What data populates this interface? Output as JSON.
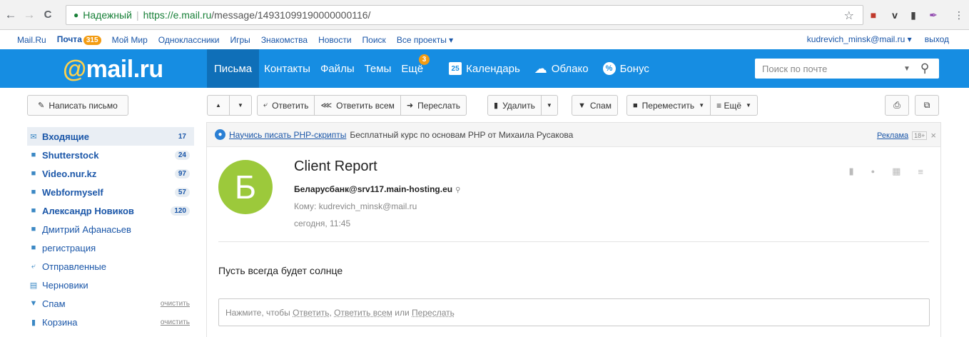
{
  "browser": {
    "back": "←",
    "forward": "→",
    "reload": "C",
    "lock": "🔒",
    "secure_label": "Надежный",
    "url_host": "https://e.mail.ru",
    "url_path": "/message/14931099190000000116/",
    "star": "☆"
  },
  "portal": {
    "links": [
      "Mail.Ru",
      "Почта",
      "Мой Мир",
      "Одноклассники",
      "Игры",
      "Знакомства",
      "Новости",
      "Поиск",
      "Все проекты ▾"
    ],
    "mail_count": "315",
    "user": "kudrevich_minsk@mail.ru ▾",
    "logout": "выход"
  },
  "header": {
    "logo_at": "@",
    "logo_text": "mail.ru",
    "nav": [
      "Письма",
      "Контакты",
      "Файлы",
      "Темы",
      "Ещё"
    ],
    "more_badge": "3",
    "calendar_day": "25",
    "calendar": "Календарь",
    "cloud": "Облако",
    "bonus": "Бонус",
    "search_placeholder": "Поиск по почте"
  },
  "toolbar": {
    "compose": "Написать письмо",
    "reply": "Ответить",
    "reply_all": "Ответить всем",
    "forward": "Переслать",
    "delete": "Удалить",
    "spam": "Спам",
    "move": "Переместить",
    "more": "≡ Ещё"
  },
  "sidebar": {
    "folders": [
      {
        "label": "Входящие",
        "count": "17",
        "bold": true
      },
      {
        "label": "Shutterstock",
        "count": "24",
        "bold": true
      },
      {
        "label": "Video.nur.kz",
        "count": "97",
        "bold": true
      },
      {
        "label": "Webformyself",
        "count": "57",
        "bold": true
      },
      {
        "label": "Александр Новиков",
        "count": "120",
        "bold": true
      },
      {
        "label": "Дмитрий Афанасьев",
        "count": "",
        "bold": false
      },
      {
        "label": "регистрация",
        "count": "",
        "bold": false
      },
      {
        "label": "Отправленные",
        "count": "",
        "bold": false
      },
      {
        "label": "Черновики",
        "count": "",
        "bold": false
      },
      {
        "label": "Спам",
        "clear": "очистить",
        "bold": false
      },
      {
        "label": "Корзина",
        "clear": "очистить",
        "bold": false
      }
    ]
  },
  "ad": {
    "link": "Научись писать PHP-скрипты",
    "text": "Бесплатный курс по основам PHP от Михаила Русакова",
    "label": "Реклама",
    "age": "18+"
  },
  "message": {
    "avatar_letter": "Б",
    "subject": "Client Report",
    "sender": "Беларусбанк@srv117.main-hosting.eu",
    "to": "Кому: kudrevich_minsk@mail.ru",
    "date": "сегодня, 11:45",
    "body": "Пусть всегда будет солнце",
    "reply_prefix": "Нажмите, чтобы",
    "reply_link1": "Ответить",
    "reply_comma": ",",
    "reply_link2": "Ответить всем",
    "reply_or": "или",
    "reply_link3": "Переслать"
  }
}
